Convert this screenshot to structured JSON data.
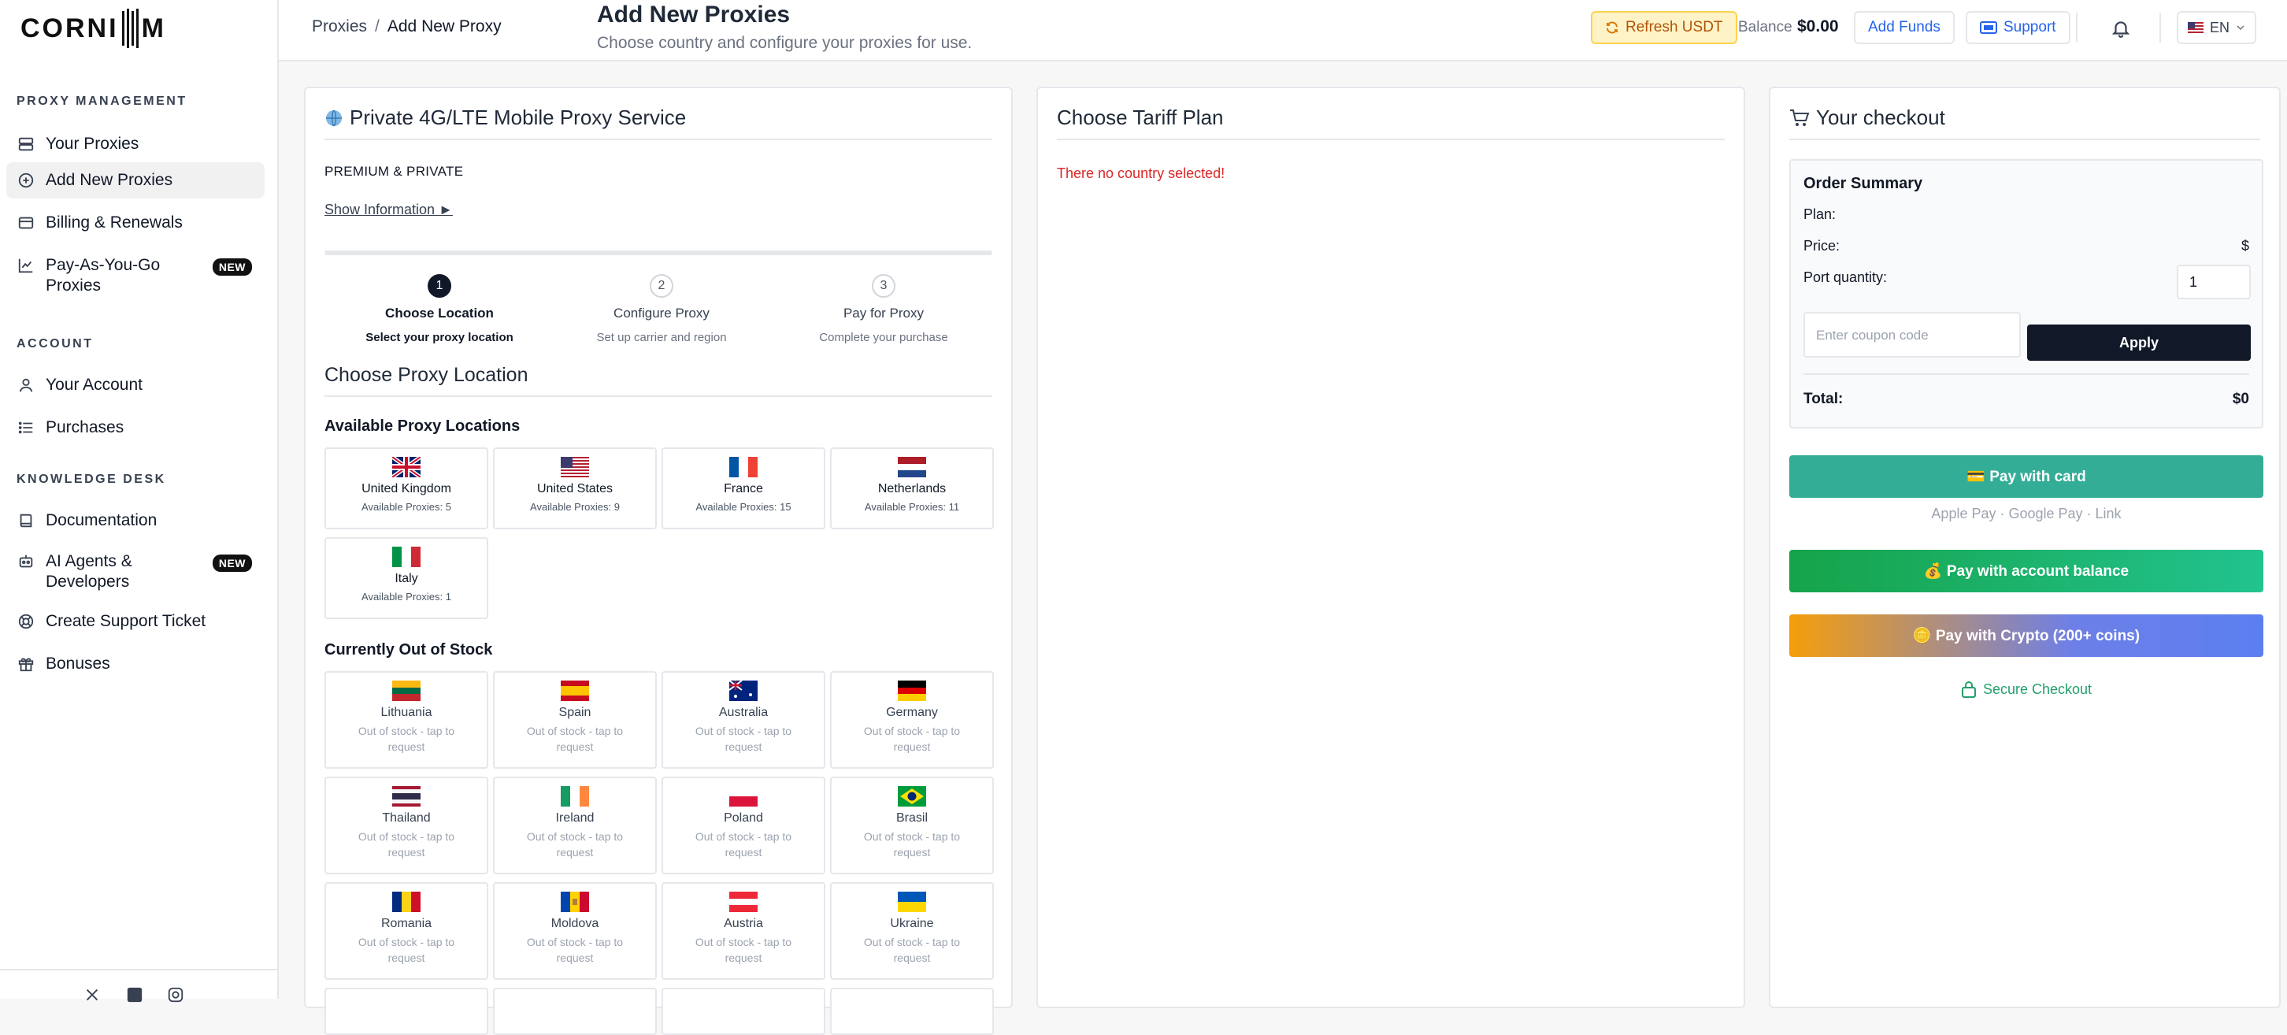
{
  "brand": {
    "logo_text": "CORNI",
    "logo_tail": "M"
  },
  "sidebar": {
    "section_proxy": "PROXY MANAGEMENT",
    "section_account": "ACCOUNT",
    "section_knowledge": "KNOWLEDGE DESK",
    "items": [
      {
        "label": "Your Proxies",
        "icon": "server-icon"
      },
      {
        "label": "Add New Proxies",
        "icon": "plus-circle-icon"
      },
      {
        "label": "Billing & Renewals",
        "icon": "credit-card-icon"
      },
      {
        "label": "Pay-As-You-Go Proxies",
        "icon": "line-chart-icon",
        "badge": "NEW"
      },
      {
        "label": "Your Account",
        "icon": "user-icon"
      },
      {
        "label": "Purchases",
        "icon": "list-icon"
      },
      {
        "label": "Documentation",
        "icon": "book-icon"
      },
      {
        "label": "AI Agents & Developers",
        "icon": "robot-icon",
        "badge": "NEW"
      },
      {
        "label": "Create Support Ticket",
        "icon": "lifebuoy-icon"
      },
      {
        "label": "Bonuses",
        "icon": "gift-icon"
      }
    ]
  },
  "header": {
    "breadcrumb_root": "Proxies",
    "breadcrumb_sep": "/",
    "breadcrumb_current": "Add New Proxy",
    "title": "Add New Proxies",
    "subtitle": "Choose country and configure your proxies for use.",
    "refresh_label": "Refresh USDT",
    "balance_label": "Balance",
    "balance_value": "$0.00",
    "add_funds_label": "Add Funds",
    "support_label": "Support",
    "language": "EN"
  },
  "service": {
    "title": "Private 4G/LTE Mobile Proxy Service",
    "tagline": "PREMIUM & PRIVATE",
    "show_info": "Show Information",
    "steps": [
      {
        "num": "1",
        "title": "Choose Location",
        "desc": "Select your proxy location"
      },
      {
        "num": "2",
        "title": "Configure Proxy",
        "desc": "Set up carrier and region"
      },
      {
        "num": "3",
        "title": "Pay for Proxy",
        "desc": "Complete your purchase"
      }
    ],
    "location_heading": "Choose Proxy Location",
    "available_heading": "Available Proxy Locations",
    "available": [
      {
        "name": "United Kingdom",
        "count": "Available Proxies: 5"
      },
      {
        "name": "United States",
        "count": "Available Proxies: 9"
      },
      {
        "name": "France",
        "count": "Available Proxies: 15"
      },
      {
        "name": "Netherlands",
        "count": "Available Proxies: 11"
      },
      {
        "name": "Italy",
        "count": "Available Proxies: 1"
      }
    ],
    "oos_heading": "Currently Out of Stock",
    "oos_text": "Out of stock - tap to request",
    "out_of_stock": [
      {
        "name": "Lithuania"
      },
      {
        "name": "Spain"
      },
      {
        "name": "Australia"
      },
      {
        "name": "Germany"
      },
      {
        "name": "Thailand"
      },
      {
        "name": "Ireland"
      },
      {
        "name": "Poland"
      },
      {
        "name": "Brasil"
      },
      {
        "name": "Romania"
      },
      {
        "name": "Moldova"
      },
      {
        "name": "Austria"
      },
      {
        "name": "Ukraine"
      }
    ]
  },
  "tariff": {
    "title": "Choose Tariff Plan",
    "error": "There no country selected!"
  },
  "checkout": {
    "title": "Your checkout",
    "summary_title": "Order Summary",
    "plan_label": "Plan:",
    "price_label": "Price:",
    "price_value": "$",
    "qty_label": "Port quantity:",
    "qty_value": "1",
    "coupon_placeholder": "Enter coupon code",
    "apply_label": "Apply",
    "total_label": "Total:",
    "total_value": "$0",
    "pay_card": "💳 Pay with card",
    "methods": "Apple Pay · Google Pay · Link",
    "pay_balance": "💰 Pay with account balance",
    "pay_crypto": "🪙 Pay with Crypto (200+ coins)",
    "secure": "Secure Checkout"
  }
}
